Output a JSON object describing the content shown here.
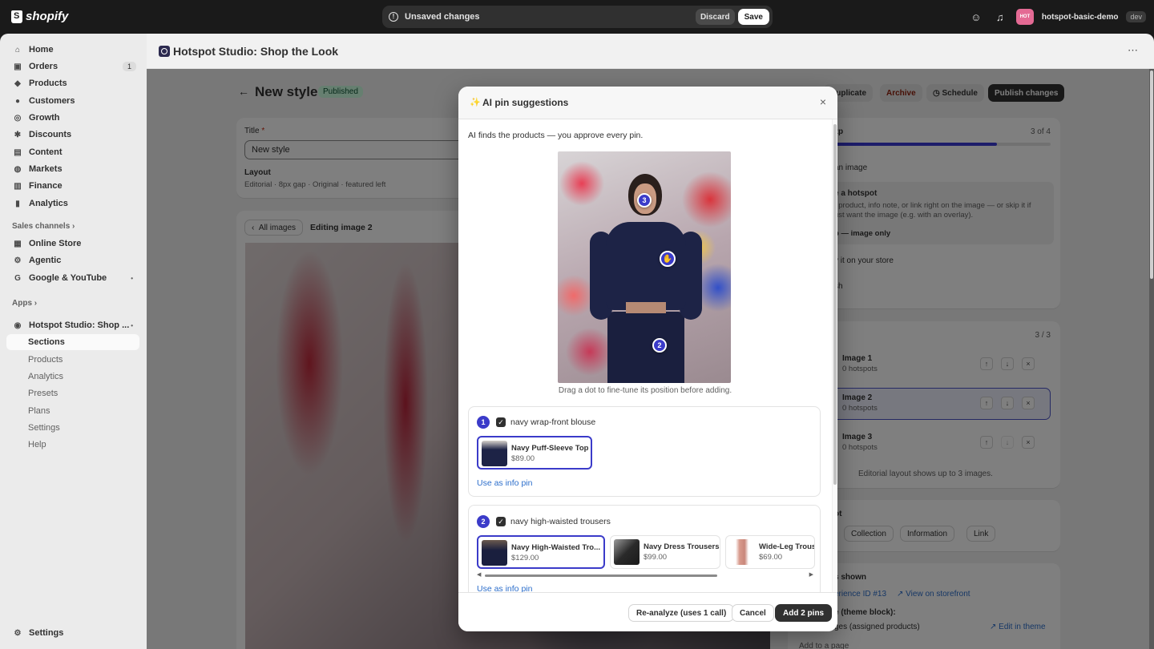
{
  "topbar": {
    "logo_text": "shopify",
    "unsaved_text": "Unsaved changes",
    "discard_label": "Discard",
    "save_label": "Save",
    "store_avatar": "HOT",
    "store_name": "hotspot-basic-demo",
    "store_badge": "dev"
  },
  "sidebar": {
    "items": [
      {
        "label": "Home",
        "icon": "home-icon",
        "glyph": "⌂"
      },
      {
        "label": "Orders",
        "icon": "orders-icon",
        "glyph": "▣",
        "count": "1"
      },
      {
        "label": "Products",
        "icon": "tag-icon",
        "glyph": "◆"
      },
      {
        "label": "Customers",
        "icon": "person-icon",
        "glyph": "●"
      },
      {
        "label": "Growth",
        "icon": "growth-icon",
        "glyph": "◎"
      },
      {
        "label": "Discounts",
        "icon": "discount-icon",
        "glyph": "✱"
      },
      {
        "label": "Content",
        "icon": "content-icon",
        "glyph": "▤"
      },
      {
        "label": "Markets",
        "icon": "globe-icon",
        "glyph": "◍"
      },
      {
        "label": "Finance",
        "icon": "bank-icon",
        "glyph": "▥"
      },
      {
        "label": "Analytics",
        "icon": "chart-icon",
        "glyph": "▮"
      }
    ],
    "sales_channels_label": "Sales channels",
    "channels": [
      {
        "label": "Online Store",
        "glyph": "▦"
      },
      {
        "label": "Agentic",
        "glyph": "⚙"
      },
      {
        "label": "Google & YouTube",
        "glyph": "G"
      }
    ],
    "apps_label": "Apps",
    "app_name": "Hotspot Studio: Shop ...",
    "app_subitems": [
      "Sections",
      "Products",
      "Analytics",
      "Presets",
      "Plans",
      "Settings",
      "Help"
    ],
    "settings_label": "Settings"
  },
  "app_header": {
    "title": "Hotspot Studio: Shop the Look"
  },
  "page": {
    "title": "New style",
    "status": "Published",
    "actions": {
      "duplicate": "Duplicate",
      "archive": "Archive",
      "schedule": "Schedule",
      "publish": "Publish changes"
    },
    "title_label": "Title",
    "title_value": "New style",
    "layout_label": "Layout",
    "layout_value": "Editorial · 8px gap · Original · featured left",
    "all_images": "All images",
    "editing": "Editing image 2"
  },
  "right": {
    "steps_frag": "zp",
    "step_count": "3 of 4",
    "progress_fraction": 0.75,
    "step1": "an image",
    "step2_title": "e a hotspot",
    "step2_text1": ", product, info note, or link right on the image — or skip it if",
    "step2_text2": "ust want the image (e.g. with an overlay).",
    "step2_action": "p — image only",
    "step3": "v it on your store",
    "step4": "sh",
    "images_count": "3 / 3",
    "images": [
      {
        "name": "Image 1",
        "hotspots": "0 hotspots"
      },
      {
        "name": "Image 2",
        "hotspots": "0 hotspots"
      },
      {
        "name": "Image 3",
        "hotspots": "0 hotspots"
      }
    ],
    "images_note": "Editorial layout shows up to 3 images.",
    "hotspot_frag": "ot",
    "hotspot_types": [
      "Collection",
      "Information",
      "Link"
    ],
    "where_frag": "s shown",
    "experience": "erience ID #13",
    "view_storefront": "View on storefront",
    "theme_block": "e (theme block):",
    "assigned": "ges (assigned products)",
    "edit_theme": "Edit in theme",
    "add_page": "Add to a page"
  },
  "modal": {
    "title": "AI pin suggestions",
    "intro": "AI finds the products — you approve every pin.",
    "caption": "Drag a dot to fine-tune its position before adding.",
    "pins": [
      "3",
      "2"
    ],
    "suggestions": [
      {
        "num": "1",
        "label": "navy wrap-front blouse",
        "products": [
          {
            "name": "Navy Puff-Sleeve Top",
            "price": "$89.00"
          }
        ],
        "link": "Use as info pin"
      },
      {
        "num": "2",
        "label": "navy high-waisted trousers",
        "products": [
          {
            "name": "Navy High-Waisted Tro...",
            "price": "$129.00"
          },
          {
            "name": "Navy Dress Trousers",
            "price": "$99.00"
          },
          {
            "name": "Wide-Leg Trous",
            "price": "$69.00"
          }
        ],
        "link": "Use as info pin"
      }
    ],
    "reanalyze": "Re-analyze (uses 1 call)",
    "cancel": "Cancel",
    "add": "Add 2 pins"
  }
}
